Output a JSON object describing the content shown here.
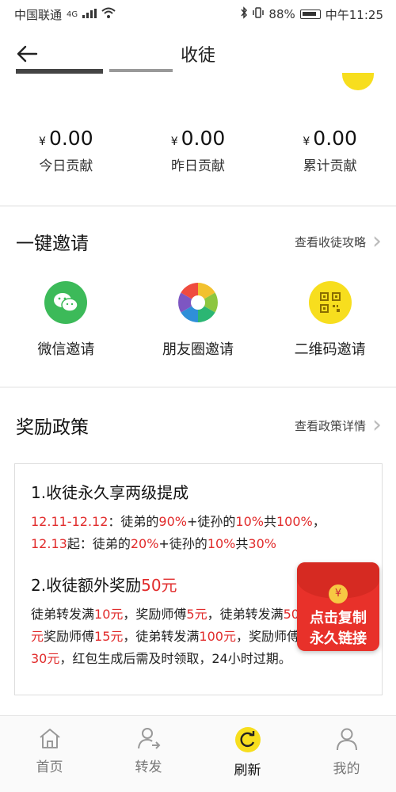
{
  "status_bar": {
    "carrier": "中国联通",
    "network": "4G",
    "battery": "88%",
    "time": "中午11:25"
  },
  "header": {
    "title": "收徒"
  },
  "stats": [
    {
      "currency": "¥",
      "value": "0.00",
      "label": "今日贡献"
    },
    {
      "currency": "¥",
      "value": "0.00",
      "label": "昨日贡献"
    },
    {
      "currency": "¥",
      "value": "0.00",
      "label": "累计贡献"
    }
  ],
  "invite": {
    "title": "一键邀请",
    "link": "查看收徒攻略",
    "options": [
      {
        "label": "微信邀请",
        "icon": "wechat-icon",
        "color": "#3cba59"
      },
      {
        "label": "朋友圈邀请",
        "icon": "moments-icon",
        "color": "#ffffff"
      },
      {
        "label": "二维码邀请",
        "icon": "qrcode-icon",
        "color": "#f7de1e"
      }
    ]
  },
  "policy": {
    "title": "奖励政策",
    "link": "查看政策详情",
    "head1": "1.收徒永久享两级提成",
    "head2_prefix": "2.收徒额外奖励",
    "head2_amount": "50元"
  },
  "floating_button": {
    "coin": "¥",
    "line1": "点击复制",
    "line2": "永久链接",
    "color": "#e8312a"
  },
  "tabs": [
    {
      "label": "首页",
      "icon": "home-icon"
    },
    {
      "label": "转发",
      "icon": "share-user-icon"
    },
    {
      "label": "刷新",
      "icon": "refresh-icon",
      "active": true
    },
    {
      "label": "我的",
      "icon": "profile-icon"
    }
  ],
  "accent": "#e12b2b",
  "brand_yellow": "#f7de1e"
}
